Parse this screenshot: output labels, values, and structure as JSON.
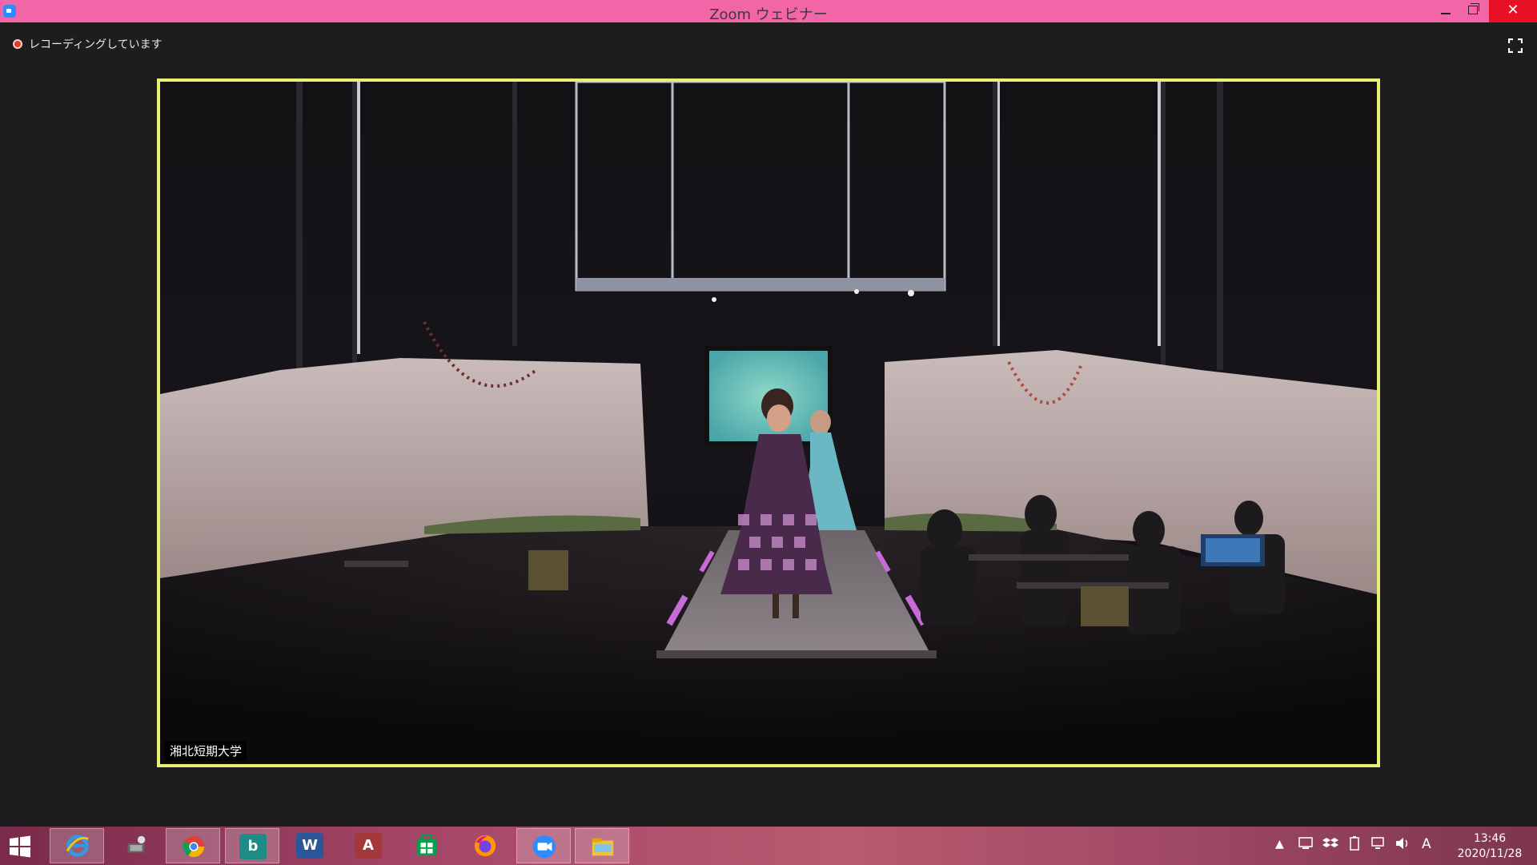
{
  "window": {
    "title": "Zoom ウェビナー",
    "minimize_icon": "minimize-icon",
    "maximize_icon": "restore-icon",
    "close_icon": "close-icon"
  },
  "recording": {
    "label": "レコーディングしています"
  },
  "video": {
    "participant_name": "湘北短期大学",
    "border_color": "#e8f07a",
    "scene": "fashion-show-stage"
  },
  "taskbar": {
    "apps": [
      {
        "name": "internet-explorer-icon"
      },
      {
        "name": "network-app-icon"
      },
      {
        "name": "chrome-icon"
      },
      {
        "name": "bing-icon"
      },
      {
        "name": "word-icon"
      },
      {
        "name": "access-icon"
      },
      {
        "name": "store-icon"
      },
      {
        "name": "firefox-icon"
      },
      {
        "name": "zoom-icon"
      },
      {
        "name": "file-explorer-icon"
      }
    ],
    "tray_ime": "A",
    "time": "13:46",
    "date": "2020/11/28"
  },
  "colors": {
    "titlebar": "#f266a8",
    "close": "#e81123",
    "video_border": "#e8f07a"
  }
}
